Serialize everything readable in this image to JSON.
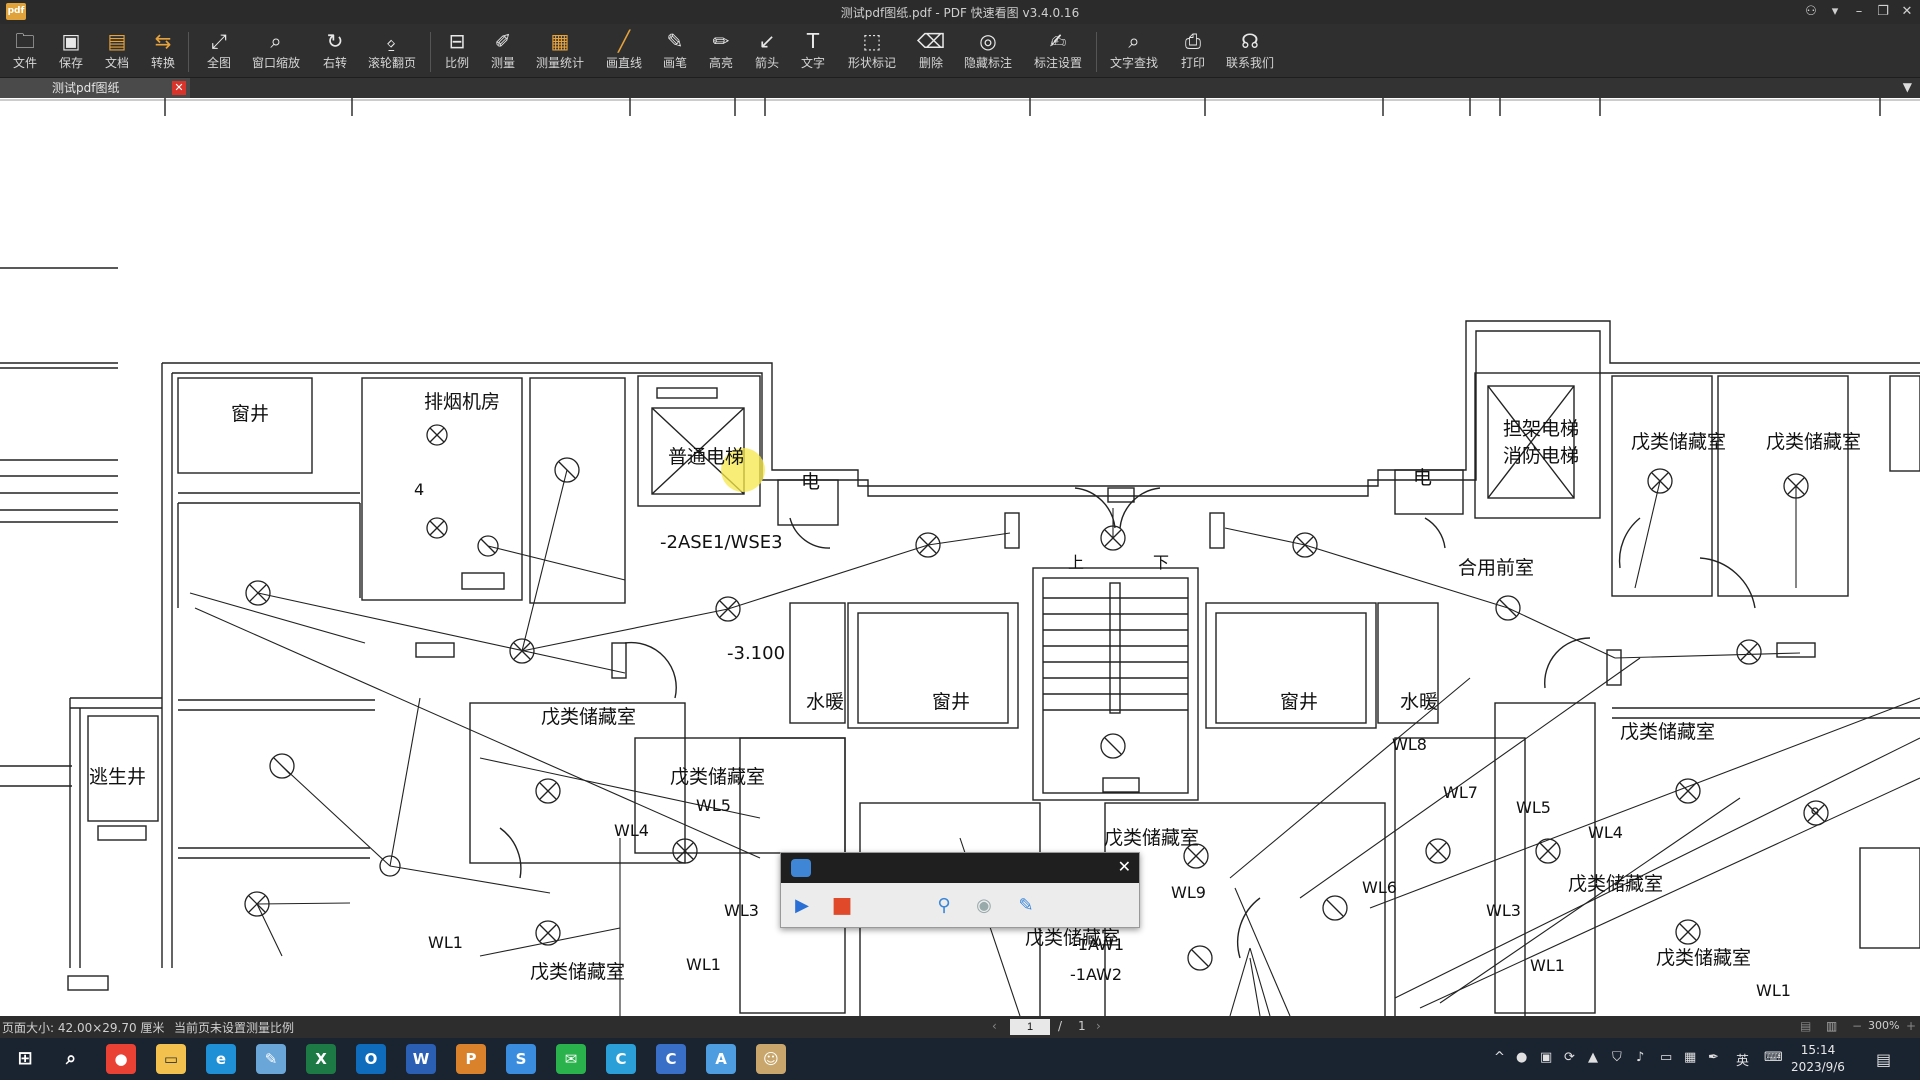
{
  "window": {
    "title": "测试pdf图纸.pdf - PDF 快速看图 v3.4.0.16",
    "app_icon_label": "pdf"
  },
  "toolbar": {
    "items": [
      {
        "label": "文件",
        "icon": "folder-icon"
      },
      {
        "label": "保存",
        "icon": "save-icon"
      },
      {
        "label": "文档",
        "icon": "document-icon"
      },
      {
        "label": "转换",
        "icon": "convert-icon"
      },
      {
        "label": "全图",
        "icon": "fit-icon"
      },
      {
        "label": "窗口缩放",
        "icon": "zoom-window-icon"
      },
      {
        "label": "右转",
        "icon": "rotate-right-icon"
      },
      {
        "label": "滚轮翻页",
        "icon": "mouse-wheel-icon"
      },
      {
        "label": "比例",
        "icon": "scale-icon"
      },
      {
        "label": "测量",
        "icon": "measure-icon"
      },
      {
        "label": "测量统计",
        "icon": "measure-stats-icon"
      },
      {
        "label": "画直线",
        "icon": "line-icon"
      },
      {
        "label": "画笔",
        "icon": "pen-icon"
      },
      {
        "label": "高亮",
        "icon": "highlighter-icon"
      },
      {
        "label": "箭头",
        "icon": "arrow-icon"
      },
      {
        "label": "文字",
        "icon": "text-icon"
      },
      {
        "label": "形状标记",
        "icon": "shape-mark-icon"
      },
      {
        "label": "删除",
        "icon": "eraser-icon"
      },
      {
        "label": "隐藏标注",
        "icon": "hide-annotation-icon"
      },
      {
        "label": "标注设置",
        "icon": "annotation-settings-icon"
      },
      {
        "label": "文字查找",
        "icon": "search-icon"
      },
      {
        "label": "打印",
        "icon": "print-icon"
      },
      {
        "label": "联系我们",
        "icon": "headset-icon"
      }
    ]
  },
  "tab": {
    "label": "测试pdf图纸",
    "close": "✕"
  },
  "drawing": {
    "rooms": [
      "窗井",
      "排烟机房",
      "普通电梯",
      "电",
      "担架电梯",
      "消防电梯",
      "电",
      "戊类储藏室",
      "戊类储藏室",
      "合用前室",
      "水暖",
      "窗井",
      "窗井",
      "水暖",
      "戊类储藏室",
      "逃生井",
      "戊类储藏室",
      "戊类储藏室",
      "戊类储藏室",
      "戊类储藏室",
      "戊类储藏室",
      "戊类储藏室",
      "戊类储藏室"
    ],
    "annotations": [
      "-2ASE1/WSE3",
      "-3.100",
      "4",
      "上",
      "下",
      "WL8",
      "WL7",
      "WL5",
      "WL4",
      "WL5",
      "WL4",
      "WL3",
      "WL1",
      "WL1",
      "WL6",
      "WL9",
      "WL6",
      "WL3",
      "WL1",
      "WL1",
      "-1AW1",
      "-1AW2",
      "WL3"
    ]
  },
  "status": {
    "page_size": "页面大小: 42.00×29.70 厘米",
    "scale_note": "当前页未设置测量比例",
    "page_current": "1",
    "page_sep": "/",
    "page_total": "1",
    "zoom": "300%"
  },
  "recorder": {
    "play": "▶",
    "stop": "■"
  },
  "taskbar": {
    "apps": [
      {
        "name": "chrome",
        "color": "#e94235",
        "glyph": "●"
      },
      {
        "name": "file-explorer",
        "color": "#f2c14e",
        "glyph": "▭"
      },
      {
        "name": "edge",
        "color": "#1f8fd6",
        "glyph": "e"
      },
      {
        "name": "notepad",
        "color": "#6aa7d8",
        "glyph": "✎"
      },
      {
        "name": "excel",
        "color": "#1d7a45",
        "glyph": "X"
      },
      {
        "name": "outlook",
        "color": "#0f6cbd",
        "glyph": "O"
      },
      {
        "name": "word",
        "color": "#2b5fb4",
        "glyph": "W"
      },
      {
        "name": "pdf-viewer",
        "color": "#d9822b",
        "glyph": "P"
      },
      {
        "name": "store-app",
        "color": "#3a8dde",
        "glyph": "S"
      },
      {
        "name": "wechat",
        "color": "#2ab24c",
        "glyph": "✉"
      },
      {
        "name": "browser-360",
        "color": "#2a9fd8",
        "glyph": "C"
      },
      {
        "name": "cad-viewer",
        "color": "#3a6fc7",
        "glyph": "C"
      },
      {
        "name": "arc-app",
        "color": "#4d9de0",
        "glyph": "A"
      },
      {
        "name": "avatar-app",
        "color": "#c9a66b",
        "glyph": "☺"
      }
    ],
    "ime": "英",
    "time": "15:14",
    "date": "2023/9/6"
  }
}
